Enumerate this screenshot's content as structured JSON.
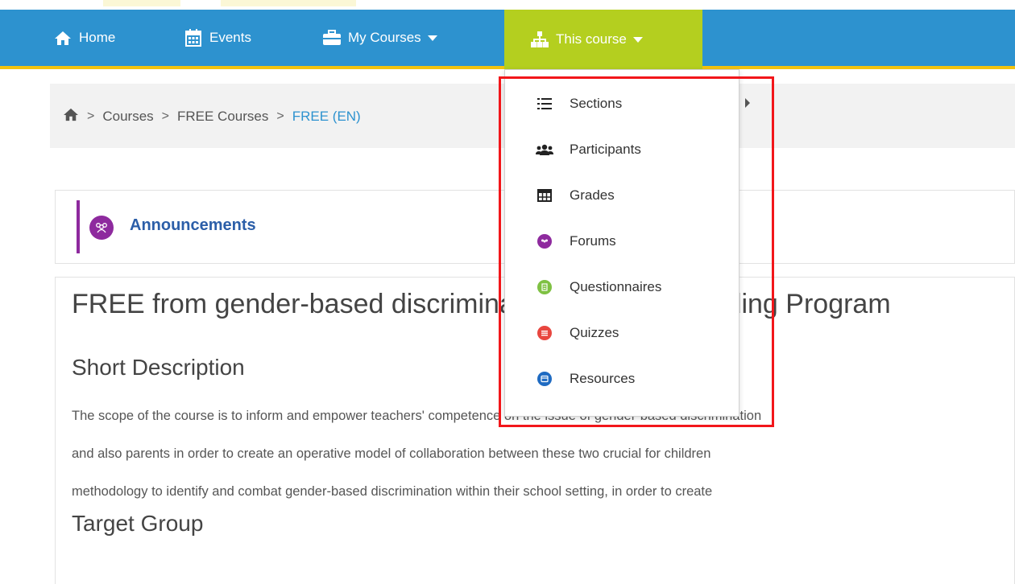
{
  "navbar": {
    "home_label": "Home",
    "events_label": "Events",
    "courses_label": "My Courses",
    "this_course_label": "This course",
    "colors": {
      "bar": "#2d92cf",
      "active": "#b4cf1f",
      "underline": "#f2c30f"
    }
  },
  "breadcrumb": {
    "items": [
      "Courses",
      "FREE Courses",
      "FREE (EN)"
    ],
    "separator": ">"
  },
  "dropdown": {
    "items": [
      {
        "label": "Sections",
        "icon": "list-ordered-icon"
      },
      {
        "label": "Participants",
        "icon": "users-icon"
      },
      {
        "label": "Grades",
        "icon": "table-icon"
      },
      {
        "label": "Forums",
        "icon": "forum-icon"
      },
      {
        "label": "Questionnaires",
        "icon": "questionnaire-icon"
      },
      {
        "label": "Quizzes",
        "icon": "quiz-icon"
      },
      {
        "label": "Resources",
        "icon": "resource-icon"
      }
    ]
  },
  "announcements": {
    "label": "Announcements",
    "accent": "#8e2a9e"
  },
  "course": {
    "title": "FREE from gender-based discrimination Capacity Building Program",
    "short_heading": "Short Description",
    "paragraph_lines": [
      "The scope of the course is to inform and empower teachers' competence on the issue of gender-based discrimination",
      "and also parents in order to create an operative model of collaboration between these two crucial for children",
      "methodology to identify and combat gender-based discrimination within their school setting, in order to create"
    ],
    "target_heading": "Target Group"
  },
  "highlight_color": "#f2161a"
}
